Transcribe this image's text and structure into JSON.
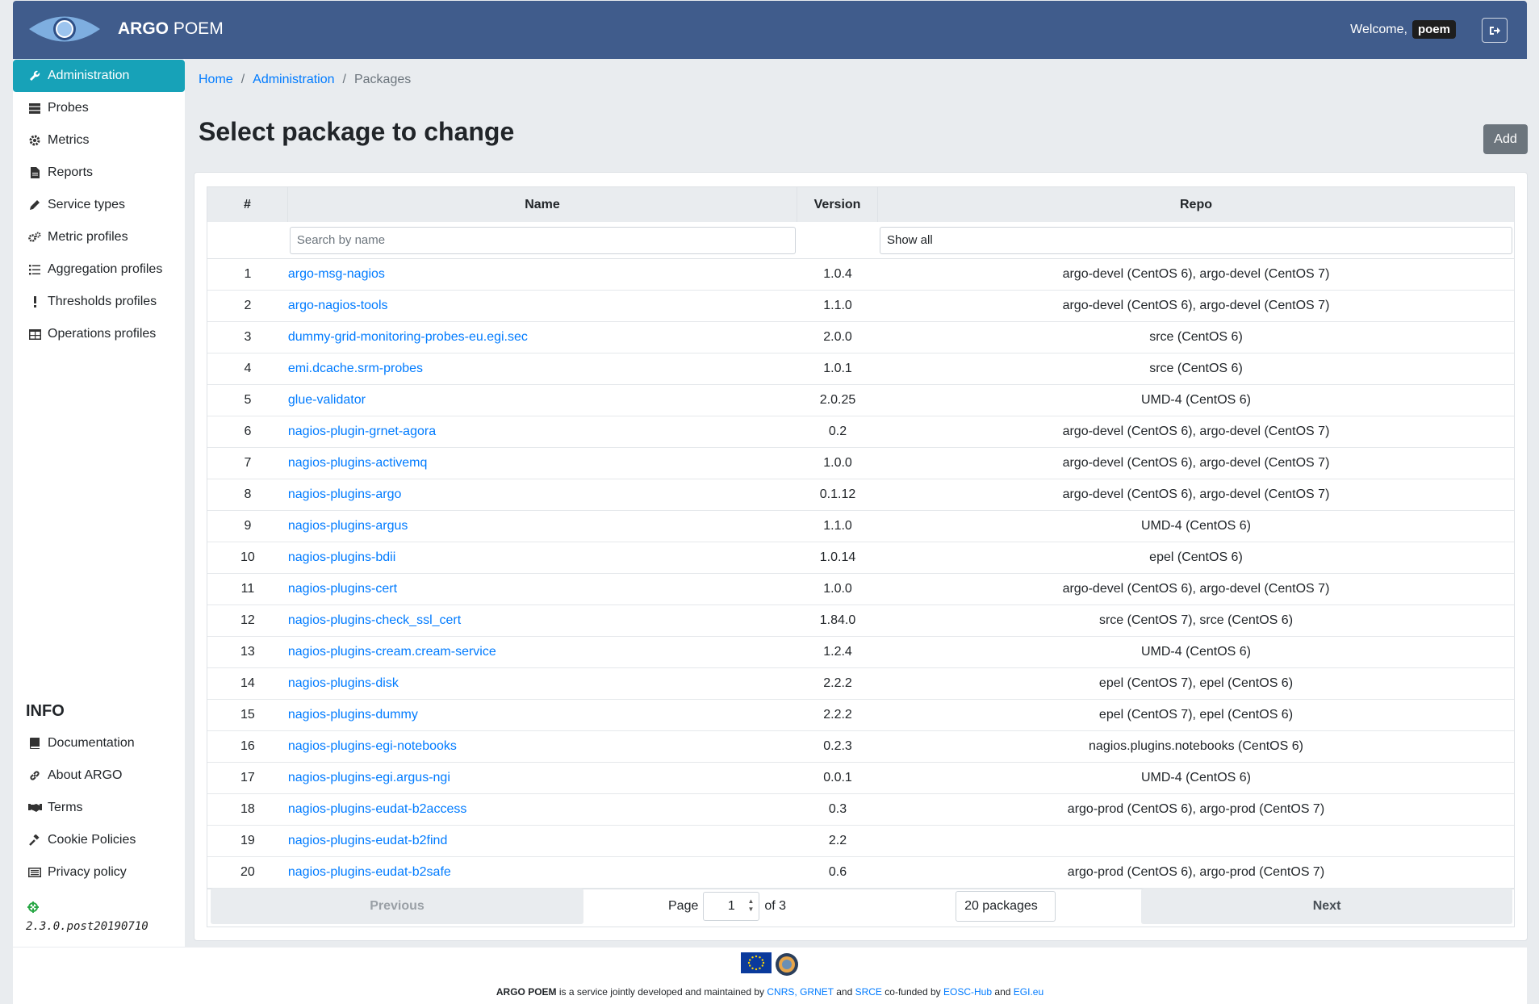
{
  "header": {
    "brand_bold": "ARGO",
    "brand_rest": "POEM",
    "welcome": "Welcome,",
    "username": "poem"
  },
  "sidebar": {
    "items": [
      {
        "label": "Administration",
        "icon": "wrench-icon"
      },
      {
        "label": "Probes",
        "icon": "server-icon"
      },
      {
        "label": "Metrics",
        "icon": "cog-icon"
      },
      {
        "label": "Reports",
        "icon": "file-icon"
      },
      {
        "label": "Service types",
        "icon": "pen-icon"
      },
      {
        "label": "Metric profiles",
        "icon": "cogs-icon"
      },
      {
        "label": "Aggregation profiles",
        "icon": "list-icon"
      },
      {
        "label": "Thresholds profiles",
        "icon": "exclamation-icon"
      },
      {
        "label": "Operations profiles",
        "icon": "table-icon"
      }
    ],
    "info_heading": "INFO",
    "info_items": [
      {
        "label": "Documentation",
        "icon": "book-icon"
      },
      {
        "label": "About ARGO",
        "icon": "link-icon"
      },
      {
        "label": "Terms",
        "icon": "handshake-icon"
      },
      {
        "label": "Cookie Policies",
        "icon": "gavel-icon"
      },
      {
        "label": "Privacy policy",
        "icon": "id-card-icon"
      }
    ],
    "version": "2.3.0.post20190710"
  },
  "breadcrumb": {
    "home": "Home",
    "admin": "Administration",
    "current": "Packages",
    "sep": "/"
  },
  "page": {
    "title": "Select package to change",
    "add_label": "Add"
  },
  "table": {
    "headers": {
      "num": "#",
      "name": "Name",
      "version": "Version",
      "repo": "Repo"
    },
    "search_placeholder": "Search by name",
    "repo_filter": "Show all",
    "rows": [
      {
        "n": "1",
        "name": "argo-msg-nagios",
        "version": "1.0.4",
        "repo": "argo-devel (CentOS 6), argo-devel (CentOS 7)"
      },
      {
        "n": "2",
        "name": "argo-nagios-tools",
        "version": "1.1.0",
        "repo": "argo-devel (CentOS 6), argo-devel (CentOS 7)"
      },
      {
        "n": "3",
        "name": "dummy-grid-monitoring-probes-eu.egi.sec",
        "version": "2.0.0",
        "repo": "srce (CentOS 6)"
      },
      {
        "n": "4",
        "name": "emi.dcache.srm-probes",
        "version": "1.0.1",
        "repo": "srce (CentOS 6)"
      },
      {
        "n": "5",
        "name": "glue-validator",
        "version": "2.0.25",
        "repo": "UMD-4 (CentOS 6)"
      },
      {
        "n": "6",
        "name": "nagios-plugin-grnet-agora",
        "version": "0.2",
        "repo": "argo-devel (CentOS 6), argo-devel (CentOS 7)"
      },
      {
        "n": "7",
        "name": "nagios-plugins-activemq",
        "version": "1.0.0",
        "repo": "argo-devel (CentOS 6), argo-devel (CentOS 7)"
      },
      {
        "n": "8",
        "name": "nagios-plugins-argo",
        "version": "0.1.12",
        "repo": "argo-devel (CentOS 6), argo-devel (CentOS 7)"
      },
      {
        "n": "9",
        "name": "nagios-plugins-argus",
        "version": "1.1.0",
        "repo": "UMD-4 (CentOS 6)"
      },
      {
        "n": "10",
        "name": "nagios-plugins-bdii",
        "version": "1.0.14",
        "repo": "epel (CentOS 6)"
      },
      {
        "n": "11",
        "name": "nagios-plugins-cert",
        "version": "1.0.0",
        "repo": "argo-devel (CentOS 6), argo-devel (CentOS 7)"
      },
      {
        "n": "12",
        "name": "nagios-plugins-check_ssl_cert",
        "version": "1.84.0",
        "repo": "srce (CentOS 7), srce (CentOS 6)"
      },
      {
        "n": "13",
        "name": "nagios-plugins-cream.cream-service",
        "version": "1.2.4",
        "repo": "UMD-4 (CentOS 6)"
      },
      {
        "n": "14",
        "name": "nagios-plugins-disk",
        "version": "2.2.2",
        "repo": "epel (CentOS 7), epel (CentOS 6)"
      },
      {
        "n": "15",
        "name": "nagios-plugins-dummy",
        "version": "2.2.2",
        "repo": "epel (CentOS 7), epel (CentOS 6)"
      },
      {
        "n": "16",
        "name": "nagios-plugins-egi-notebooks",
        "version": "0.2.3",
        "repo": "nagios.plugins.notebooks (CentOS 6)"
      },
      {
        "n": "17",
        "name": "nagios-plugins-egi.argus-ngi",
        "version": "0.0.1",
        "repo": "UMD-4 (CentOS 6)"
      },
      {
        "n": "18",
        "name": "nagios-plugins-eudat-b2access",
        "version": "0.3",
        "repo": "argo-prod (CentOS 6), argo-prod (CentOS 7)"
      },
      {
        "n": "19",
        "name": "nagios-plugins-eudat-b2find",
        "version": "2.2",
        "repo": ""
      },
      {
        "n": "20",
        "name": "nagios-plugins-eudat-b2safe",
        "version": "0.6",
        "repo": "argo-prod (CentOS 6), argo-prod (CentOS 7)"
      }
    ]
  },
  "pager": {
    "previous": "Previous",
    "page_label": "Page",
    "page_value": "1",
    "of_label": "of 3",
    "page_size": "20 packages",
    "next": "Next"
  },
  "footer": {
    "brand": "ARGO POEM",
    "text1": "is a service jointly developed and maintained by",
    "cnrs": "CNRS,",
    "grnet": "GRNET",
    "and1": "and",
    "srce": "SRCE",
    "cofunded": "co-funded by",
    "eosc": "EOSC-Hub",
    "and2": "and",
    "egi": "EGI.eu"
  },
  "colors": {
    "header": "#405c8c",
    "active": "#17a2b8",
    "link": "#007bff"
  }
}
